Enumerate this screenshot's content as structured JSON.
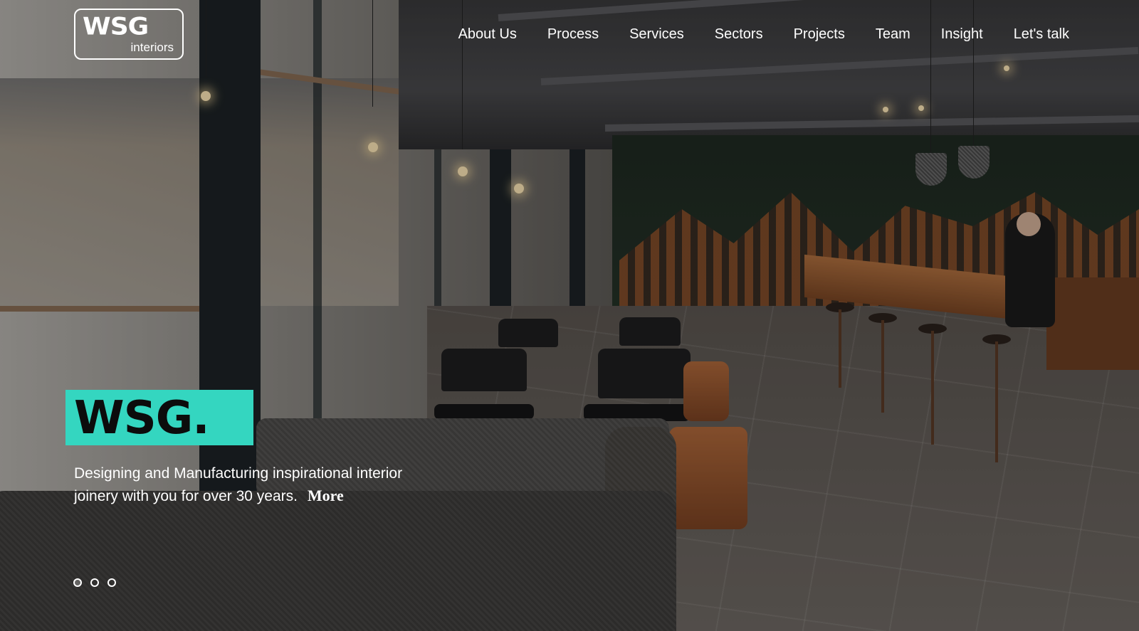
{
  "logo": {
    "mark": "WSG",
    "sub": "interiors"
  },
  "nav": {
    "items": [
      "About Us",
      "Process",
      "Services",
      "Sectors",
      "Projects",
      "Team",
      "Insight",
      "Let's talk"
    ]
  },
  "hero": {
    "badge_text": "WSG.",
    "tagline": "Designing and Manufacturing inspirational interior joinery with you for over 30 years.",
    "more_label": "More"
  },
  "slider": {
    "count": 3,
    "active": 1
  },
  "colors": {
    "accent": "#34d6c0",
    "text": "#ffffff"
  }
}
